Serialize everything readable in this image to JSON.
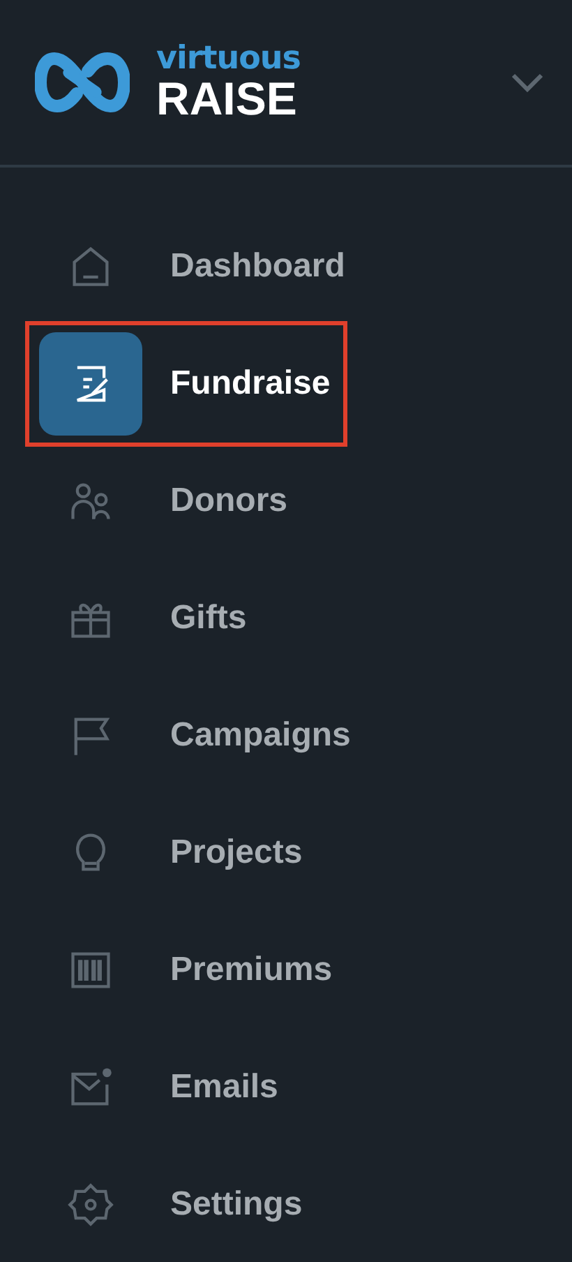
{
  "brand": {
    "top": "virtuous",
    "bottom": "RAISE"
  },
  "header": {
    "expanded": false
  },
  "nav": [
    {
      "label": "Dashboard",
      "selected": false,
      "highlighted": false
    },
    {
      "label": "Fundraise",
      "selected": true,
      "highlighted": true
    },
    {
      "label": "Donors",
      "selected": false,
      "highlighted": false
    },
    {
      "label": "Gifts",
      "selected": false,
      "highlighted": false
    },
    {
      "label": "Campaigns",
      "selected": false,
      "highlighted": false
    },
    {
      "label": "Projects",
      "selected": false,
      "highlighted": false
    },
    {
      "label": "Premiums",
      "selected": false,
      "highlighted": false
    },
    {
      "label": "Emails",
      "selected": false,
      "highlighted": false
    },
    {
      "label": "Settings",
      "selected": false,
      "highlighted": false
    }
  ]
}
